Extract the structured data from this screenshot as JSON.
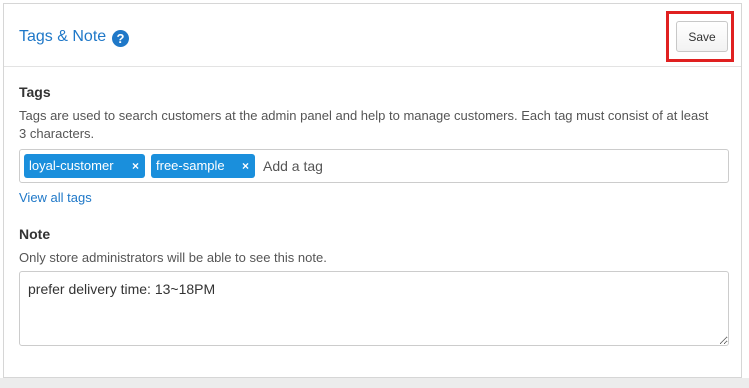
{
  "header": {
    "title": "Tags & Note",
    "help_glyph": "?",
    "save_label": "Save",
    "highlight_color": "#e02020"
  },
  "tags_section": {
    "label": "Tags",
    "description": "Tags are used to search customers at the admin panel and help to manage customers. Each tag must consist of at least 3 characters.",
    "tags": [
      {
        "label": "loyal-customer",
        "remove": "×"
      },
      {
        "label": "free-sample",
        "remove": "×"
      }
    ],
    "input_placeholder": "Add a tag",
    "view_all_link": "View all tags",
    "tag_color": "#1a8fdc"
  },
  "note_section": {
    "label": "Note",
    "description": "Only store administrators will be able to see this note.",
    "value": "prefer delivery time: 13~18PM"
  },
  "colors": {
    "accent": "#1f78c8"
  }
}
